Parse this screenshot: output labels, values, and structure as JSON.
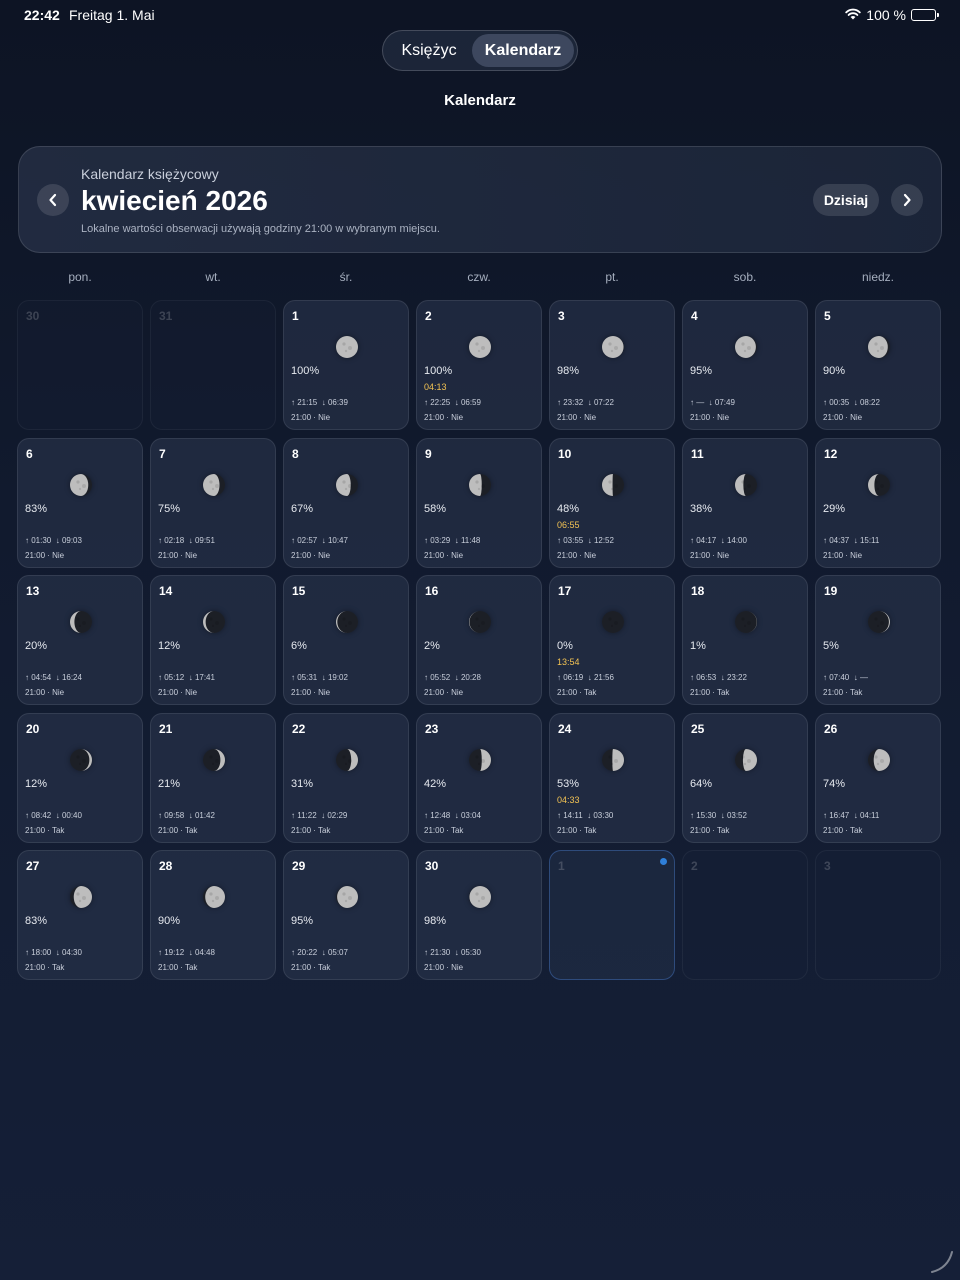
{
  "status": {
    "time": "22:42",
    "date": "Freitag 1. Mai",
    "battery": "100 %"
  },
  "segment": {
    "moon": "Księżyc",
    "calendar": "Kalendarz",
    "active": "calendar"
  },
  "page_title": "Kalendarz",
  "header": {
    "subtitle": "Kalendarz księżycowy",
    "month": "kwiecień 2026",
    "note": "Lokalne wartości obserwacji używają godziny 21:00 w wybranym miejscu.",
    "today_label": "Dzisiaj"
  },
  "weekdays": [
    "pon.",
    "wt.",
    "śr.",
    "czw.",
    "pt.",
    "sob.",
    "niedz."
  ],
  "days": [
    {
      "n": "30",
      "out": true
    },
    {
      "n": "31",
      "out": true
    },
    {
      "n": "1",
      "illum": "100%",
      "phase": "",
      "rise": "21:15",
      "set": "06:39",
      "obs": "21:00 · Nie",
      "frac": 1.0,
      "waxing": false
    },
    {
      "n": "2",
      "illum": "100%",
      "phase": "04:13",
      "rise": "22:25",
      "set": "06:59",
      "obs": "21:00 · Nie",
      "frac": 1.0,
      "waxing": false
    },
    {
      "n": "3",
      "illum": "98%",
      "phase": "",
      "rise": "23:32",
      "set": "07:22",
      "obs": "21:00 · Nie",
      "frac": 0.98,
      "waxing": false
    },
    {
      "n": "4",
      "illum": "95%",
      "phase": "",
      "rise": "—",
      "set": "07:49",
      "obs": "21:00 · Nie",
      "frac": 0.95,
      "waxing": false
    },
    {
      "n": "5",
      "illum": "90%",
      "phase": "",
      "rise": "00:35",
      "set": "08:22",
      "obs": "21:00 · Nie",
      "frac": 0.9,
      "waxing": false
    },
    {
      "n": "6",
      "illum": "83%",
      "phase": "",
      "rise": "01:30",
      "set": "09:03",
      "obs": "21:00 · Nie",
      "frac": 0.83,
      "waxing": false
    },
    {
      "n": "7",
      "illum": "75%",
      "phase": "",
      "rise": "02:18",
      "set": "09:51",
      "obs": "21:00 · Nie",
      "frac": 0.75,
      "waxing": false
    },
    {
      "n": "8",
      "illum": "67%",
      "phase": "",
      "rise": "02:57",
      "set": "10:47",
      "obs": "21:00 · Nie",
      "frac": 0.67,
      "waxing": false
    },
    {
      "n": "9",
      "illum": "58%",
      "phase": "",
      "rise": "03:29",
      "set": "11:48",
      "obs": "21:00 · Nie",
      "frac": 0.58,
      "waxing": false
    },
    {
      "n": "10",
      "illum": "48%",
      "phase": "06:55",
      "rise": "03:55",
      "set": "12:52",
      "obs": "21:00 · Nie",
      "frac": 0.48,
      "waxing": false
    },
    {
      "n": "11",
      "illum": "38%",
      "phase": "",
      "rise": "04:17",
      "set": "14:00",
      "obs": "21:00 · Nie",
      "frac": 0.38,
      "waxing": false
    },
    {
      "n": "12",
      "illum": "29%",
      "phase": "",
      "rise": "04:37",
      "set": "15:11",
      "obs": "21:00 · Nie",
      "frac": 0.29,
      "waxing": false
    },
    {
      "n": "13",
      "illum": "20%",
      "phase": "",
      "rise": "04:54",
      "set": "16:24",
      "obs": "21:00 · Nie",
      "frac": 0.2,
      "waxing": false
    },
    {
      "n": "14",
      "illum": "12%",
      "phase": "",
      "rise": "05:12",
      "set": "17:41",
      "obs": "21:00 · Nie",
      "frac": 0.12,
      "waxing": false
    },
    {
      "n": "15",
      "illum": "6%",
      "phase": "",
      "rise": "05:31",
      "set": "19:02",
      "obs": "21:00 · Nie",
      "frac": 0.06,
      "waxing": false
    },
    {
      "n": "16",
      "illum": "2%",
      "phase": "",
      "rise": "05:52",
      "set": "20:28",
      "obs": "21:00 · Nie",
      "frac": 0.02,
      "waxing": false
    },
    {
      "n": "17",
      "illum": "0%",
      "phase": "13:54",
      "rise": "06:19",
      "set": "21:56",
      "obs": "21:00 · Tak",
      "frac": 0.0,
      "waxing": true
    },
    {
      "n": "18",
      "illum": "1%",
      "phase": "",
      "rise": "06:53",
      "set": "23:22",
      "obs": "21:00 · Tak",
      "frac": 0.01,
      "waxing": true
    },
    {
      "n": "19",
      "illum": "5%",
      "phase": "",
      "rise": "07:40",
      "set": "—",
      "obs": "21:00 · Tak",
      "frac": 0.05,
      "waxing": true
    },
    {
      "n": "20",
      "illum": "12%",
      "phase": "",
      "rise": "08:42",
      "set": "00:40",
      "obs": "21:00 · Tak",
      "frac": 0.12,
      "waxing": true
    },
    {
      "n": "21",
      "illum": "21%",
      "phase": "",
      "rise": "09:58",
      "set": "01:42",
      "obs": "21:00 · Tak",
      "frac": 0.21,
      "waxing": true
    },
    {
      "n": "22",
      "illum": "31%",
      "phase": "",
      "rise": "11:22",
      "set": "02:29",
      "obs": "21:00 · Tak",
      "frac": 0.31,
      "waxing": true
    },
    {
      "n": "23",
      "illum": "42%",
      "phase": "",
      "rise": "12:48",
      "set": "03:04",
      "obs": "21:00 · Tak",
      "frac": 0.42,
      "waxing": true
    },
    {
      "n": "24",
      "illum": "53%",
      "phase": "04:33",
      "rise": "14:11",
      "set": "03:30",
      "obs": "21:00 · Tak",
      "frac": 0.53,
      "waxing": true
    },
    {
      "n": "25",
      "illum": "64%",
      "phase": "",
      "rise": "15:30",
      "set": "03:52",
      "obs": "21:00 · Tak",
      "frac": 0.64,
      "waxing": true
    },
    {
      "n": "26",
      "illum": "74%",
      "phase": "",
      "rise": "16:47",
      "set": "04:11",
      "obs": "21:00 · Tak",
      "frac": 0.74,
      "waxing": true
    },
    {
      "n": "27",
      "illum": "83%",
      "phase": "",
      "rise": "18:00",
      "set": "04:30",
      "obs": "21:00 · Tak",
      "frac": 0.83,
      "waxing": true
    },
    {
      "n": "28",
      "illum": "90%",
      "phase": "",
      "rise": "19:12",
      "set": "04:48",
      "obs": "21:00 · Tak",
      "frac": 0.9,
      "waxing": true
    },
    {
      "n": "29",
      "illum": "95%",
      "phase": "",
      "rise": "20:22",
      "set": "05:07",
      "obs": "21:00 · Tak",
      "frac": 0.95,
      "waxing": true
    },
    {
      "n": "30",
      "illum": "98%",
      "phase": "",
      "rise": "21:30",
      "set": "05:30",
      "obs": "21:00 · Nie",
      "frac": 0.98,
      "waxing": true
    },
    {
      "n": "1",
      "out": true,
      "today": true
    },
    {
      "n": "2",
      "out": true
    },
    {
      "n": "3",
      "out": true
    }
  ],
  "icons": {
    "wifi": "wifi-icon",
    "battery": "battery-icon",
    "prev": "chevron-left-icon",
    "next": "chevron-right-icon",
    "rise": "arrow-up-icon",
    "set": "arrow-down-icon",
    "moon": "moon-phase-icon"
  },
  "colors": {
    "phase_time": "#f2c253",
    "today_dot": "#2f7fd8",
    "moon_lit": "#bdbdbd",
    "moon_dark": "#1c1f26"
  }
}
